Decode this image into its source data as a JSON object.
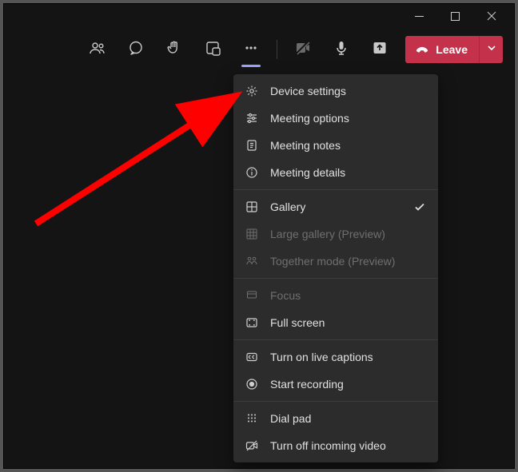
{
  "toolbar": {
    "leave_label": "Leave"
  },
  "menu": {
    "items": [
      {
        "label": "Device settings"
      },
      {
        "label": "Meeting options"
      },
      {
        "label": "Meeting notes"
      },
      {
        "label": "Meeting details"
      }
    ],
    "view": [
      {
        "label": "Gallery",
        "checked": true
      },
      {
        "label": "Large gallery (Preview)",
        "disabled": true
      },
      {
        "label": "Together mode (Preview)",
        "disabled": true
      }
    ],
    "screen": [
      {
        "label": "Focus",
        "disabled": true
      },
      {
        "label": "Full screen"
      }
    ],
    "captions": [
      {
        "label": "Turn on live captions"
      },
      {
        "label": "Start recording"
      }
    ],
    "other": [
      {
        "label": "Dial pad"
      },
      {
        "label": "Turn off incoming video"
      }
    ]
  }
}
